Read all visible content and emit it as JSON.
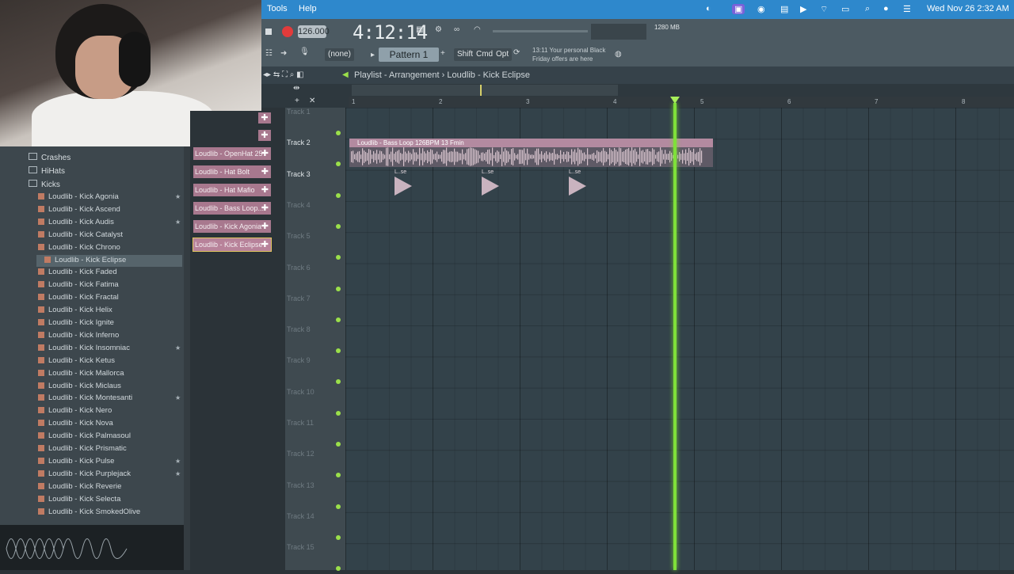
{
  "menubar": {
    "menus": [
      "Tools",
      "Help"
    ],
    "datetime": "Wed Nov 26  2:32 AM"
  },
  "transport": {
    "tempo": "126.000",
    "time": "4:12:14",
    "pattern": "Pattern 1",
    "none_label": "(none)",
    "buttons": [
      "Shift",
      "Cmd",
      "Opt"
    ],
    "hint_line1": "13:11  Your personal Black",
    "hint_line2": "Friday offers are here",
    "mem": "1280 MB",
    "mem_sub": "1"
  },
  "playlist": {
    "title": "Playlist - Arrangement",
    "separator": "›",
    "current": "Loudlib - Kick Eclipse",
    "ruler": [
      "1",
      "2",
      "3",
      "4",
      "5",
      "6",
      "7",
      "8"
    ],
    "tracks": [
      "Track 1",
      "Track 2",
      "Track 3",
      "Track 4",
      "Track 5",
      "Track 6",
      "Track 7",
      "Track 8",
      "Track 9",
      "Track 10",
      "Track 11",
      "Track 12",
      "Track 13",
      "Track 14",
      "Track 15"
    ],
    "bass_clip": "Loudlib - Bass Loop 126BPM 13 Fmin",
    "kick_clip": "L..se"
  },
  "browser": {
    "folders": [
      "Crashes",
      "HiHats",
      "Kicks"
    ],
    "items": [
      {
        "label": "Loudlib - Kick Agonia",
        "star": true
      },
      {
        "label": "Loudlib - Kick Ascend",
        "star": false
      },
      {
        "label": "Loudlib - Kick Audis",
        "star": true
      },
      {
        "label": "Loudlib - Kick Catalyst",
        "star": false
      },
      {
        "label": "Loudlib - Kick Chrono",
        "star": false
      },
      {
        "label": "Loudlib - Kick Eclipse",
        "star": false
      },
      {
        "label": "Loudlib - Kick Faded",
        "star": false
      },
      {
        "label": "Loudlib - Kick Fatima",
        "star": false
      },
      {
        "label": "Loudlib - Kick Fractal",
        "star": false
      },
      {
        "label": "Loudlib - Kick Helix",
        "star": false
      },
      {
        "label": "Loudlib - Kick Ignite",
        "star": false
      },
      {
        "label": "Loudlib - Kick Inferno",
        "star": false
      },
      {
        "label": "Loudlib - Kick Insomniac",
        "star": true
      },
      {
        "label": "Loudlib - Kick Ketus",
        "star": false
      },
      {
        "label": "Loudlib - Kick Mallorca",
        "star": false
      },
      {
        "label": "Loudlib - Kick Miclaus",
        "star": false
      },
      {
        "label": "Loudlib - Kick Montesanti",
        "star": true
      },
      {
        "label": "Loudlib - Kick Nero",
        "star": false
      },
      {
        "label": "Loudlib - Kick Nova",
        "star": false
      },
      {
        "label": "Loudlib - Kick Palmasoul",
        "star": false
      },
      {
        "label": "Loudlib - Kick Prismatic",
        "star": false
      },
      {
        "label": "Loudlib - Kick Pulse",
        "star": true
      },
      {
        "label": "Loudlib - Kick Purplejack",
        "star": true
      },
      {
        "label": "Loudlib - Kick Reverie",
        "star": false
      },
      {
        "label": "Loudlib - Kick Selecta",
        "star": false
      },
      {
        "label": "Loudlib - Kick SmokedOlive",
        "star": false
      }
    ],
    "selected_index": 5
  },
  "picker": {
    "items": [
      "Loudlib - OpenHat 25",
      "Loudlib - Hat Bolt",
      "Loudlib - Hat Mafio",
      "Loudlib - Bass Loop...",
      "Loudlib - Kick Agonia",
      "Loudlib - Kick Eclipse"
    ],
    "selected_index": 5
  },
  "colors": {
    "accent": "#2e88cc",
    "clip": "#b38aa0",
    "playhead": "#7fe03a"
  }
}
